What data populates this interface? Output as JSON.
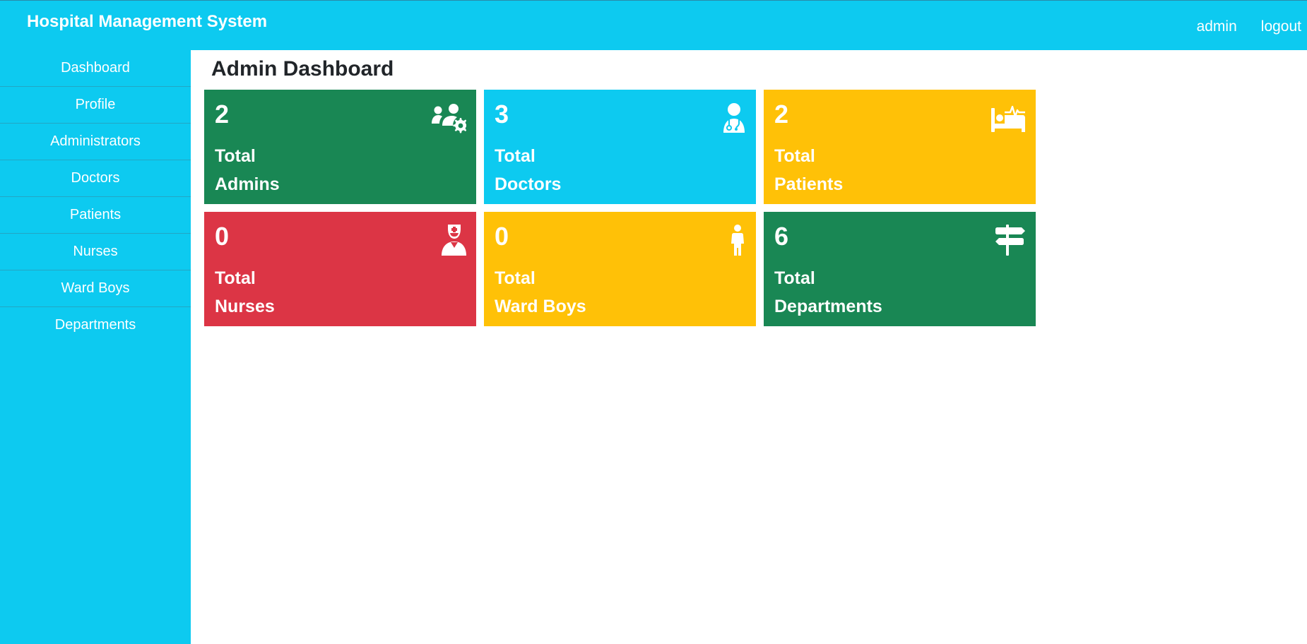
{
  "header": {
    "brand": "Hospital Management System",
    "links": [
      "admin",
      "logout"
    ]
  },
  "sidebar": {
    "items": [
      {
        "label": "Dashboard"
      },
      {
        "label": "Profile"
      },
      {
        "label": "Administrators"
      },
      {
        "label": "Doctors"
      },
      {
        "label": "Patients"
      },
      {
        "label": "Nurses"
      },
      {
        "label": "Ward Boys"
      },
      {
        "label": "Departments"
      }
    ]
  },
  "main": {
    "title": "Admin Dashboard",
    "cards": [
      {
        "count": "2",
        "line1": "Total",
        "line2": "Admins",
        "color": "#198754",
        "icon": "users-gear-icon"
      },
      {
        "count": "3",
        "line1": "Total",
        "line2": "Doctors",
        "color": "#0dcaf0",
        "icon": "user-doctor-icon"
      },
      {
        "count": "2",
        "line1": "Total",
        "line2": "Patients",
        "color": "#ffc107",
        "icon": "bed-pulse-icon"
      },
      {
        "count": "0",
        "line1": "Total",
        "line2": "Nurses",
        "color": "#dc3545",
        "icon": "user-nurse-icon"
      },
      {
        "count": "0",
        "line1": "Total",
        "line2": "Ward Boys",
        "color": "#ffc107",
        "icon": "child-icon"
      },
      {
        "count": "6",
        "line1": "Total",
        "line2": "Departments",
        "color": "#198754",
        "icon": "signs-post-icon"
      }
    ]
  },
  "colors": {
    "primary": "#0dcaf0",
    "success": "#198754",
    "warning": "#ffc107",
    "danger": "#dc3545"
  }
}
